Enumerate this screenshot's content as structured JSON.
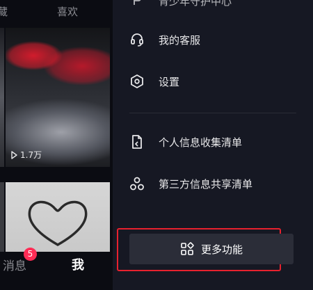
{
  "left_panel": {
    "tabs": [
      "藏",
      "喜欢"
    ],
    "video": {
      "views": "1.7万"
    },
    "bottom_nav": {
      "messages_label": "消息",
      "messages_badge": "5",
      "me_label": "我"
    }
  },
  "menu": {
    "partial_item": "青少年守护中心",
    "items": [
      {
        "label": "我的客服",
        "icon": "headset-icon"
      },
      {
        "label": "设置",
        "icon": "settings-hexagon-icon"
      },
      {
        "label": "个人信息收集清单",
        "icon": "document-list-icon"
      },
      {
        "label": "第三方信息共享清单",
        "icon": "share-nodes-icon"
      }
    ],
    "more_button": {
      "label": "更多功能",
      "icon": "grid-apps-icon"
    }
  },
  "colors": {
    "panel_bg": "#161823",
    "highlight_border": "#e8212e",
    "badge": "#fe2c55"
  }
}
